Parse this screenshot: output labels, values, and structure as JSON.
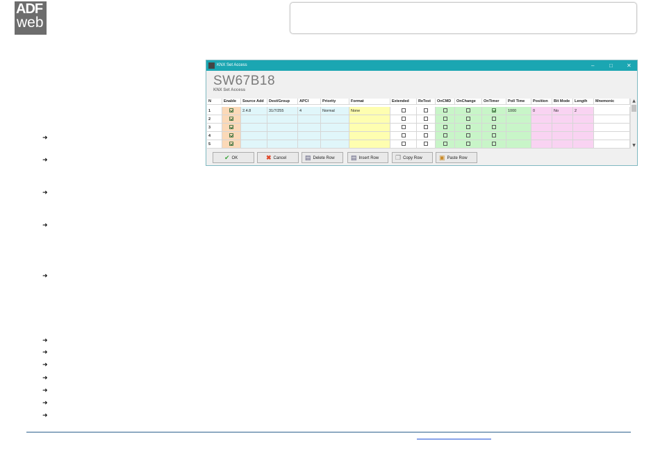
{
  "logo": {
    "line1": "ADF",
    "line2": "web"
  },
  "window": {
    "title": "KNX Set Access",
    "minimize": "–",
    "maximize": "□",
    "close": "✕",
    "product": "SW67B18",
    "subtitle": "KNX Set Access"
  },
  "table": {
    "columns": [
      "N",
      "Enable",
      "Source Add",
      "Dest/Group",
      "APCI",
      "Priority",
      "Format",
      "Extended",
      "ReTest",
      "OnCMD",
      "OnChange",
      "OnTimer",
      "Poll Time",
      "Position",
      "Bit Mode",
      "Length",
      "Mnemonic"
    ],
    "rows": [
      {
        "n": "1",
        "enable": true,
        "source": "2.4.8",
        "dest": "31/7/255",
        "apci": "4",
        "priority": "Normal",
        "format": "None",
        "extended": false,
        "retest": false,
        "oncmd": false,
        "onchange": false,
        "ontimer": true,
        "poll": "1000",
        "position": "0",
        "bitmode": "No",
        "length": "2",
        "mnemonic": ""
      },
      {
        "n": "2",
        "enable": true,
        "source": "",
        "dest": "",
        "apci": "",
        "priority": "",
        "format": "",
        "extended": false,
        "retest": false,
        "oncmd": false,
        "onchange": false,
        "ontimer": false,
        "poll": "",
        "position": "",
        "bitmode": "",
        "length": "",
        "mnemonic": ""
      },
      {
        "n": "3",
        "enable": true,
        "source": "",
        "dest": "",
        "apci": "",
        "priority": "",
        "format": "",
        "extended": false,
        "retest": false,
        "oncmd": false,
        "onchange": false,
        "ontimer": false,
        "poll": "",
        "position": "",
        "bitmode": "",
        "length": "",
        "mnemonic": ""
      },
      {
        "n": "4",
        "enable": true,
        "source": "",
        "dest": "",
        "apci": "",
        "priority": "",
        "format": "",
        "extended": false,
        "retest": false,
        "oncmd": false,
        "onchange": false,
        "ontimer": false,
        "poll": "",
        "position": "",
        "bitmode": "",
        "length": "",
        "mnemonic": ""
      },
      {
        "n": "5",
        "enable": true,
        "source": "",
        "dest": "",
        "apci": "",
        "priority": "",
        "format": "",
        "extended": false,
        "retest": false,
        "oncmd": false,
        "onchange": false,
        "ontimer": false,
        "poll": "",
        "position": "",
        "bitmode": "",
        "length": "",
        "mnemonic": ""
      }
    ]
  },
  "buttons": {
    "ok": "OK",
    "cancel": "Cancel",
    "delete_row": "Delete Row",
    "insert_row": "Insert Row",
    "copy_row": "Copy Row",
    "paste_row": "Paste Row"
  },
  "colors": {
    "titlebar": "#1ba6b2",
    "enable_col": "#fbd9b8",
    "address_cols": "#e0f6fa",
    "format_col": "#fefeb0",
    "flag_cols": "#c8f5c8",
    "position_cols": "#f9d3f2"
  },
  "icons": {
    "bullet": "arrow-bullet-icon",
    "ok": "checkmark-icon",
    "cancel": "x-icon",
    "delete_row": "delete-row-icon",
    "insert_row": "insert-row-icon",
    "copy_row": "copy-icon",
    "paste_row": "paste-icon"
  }
}
